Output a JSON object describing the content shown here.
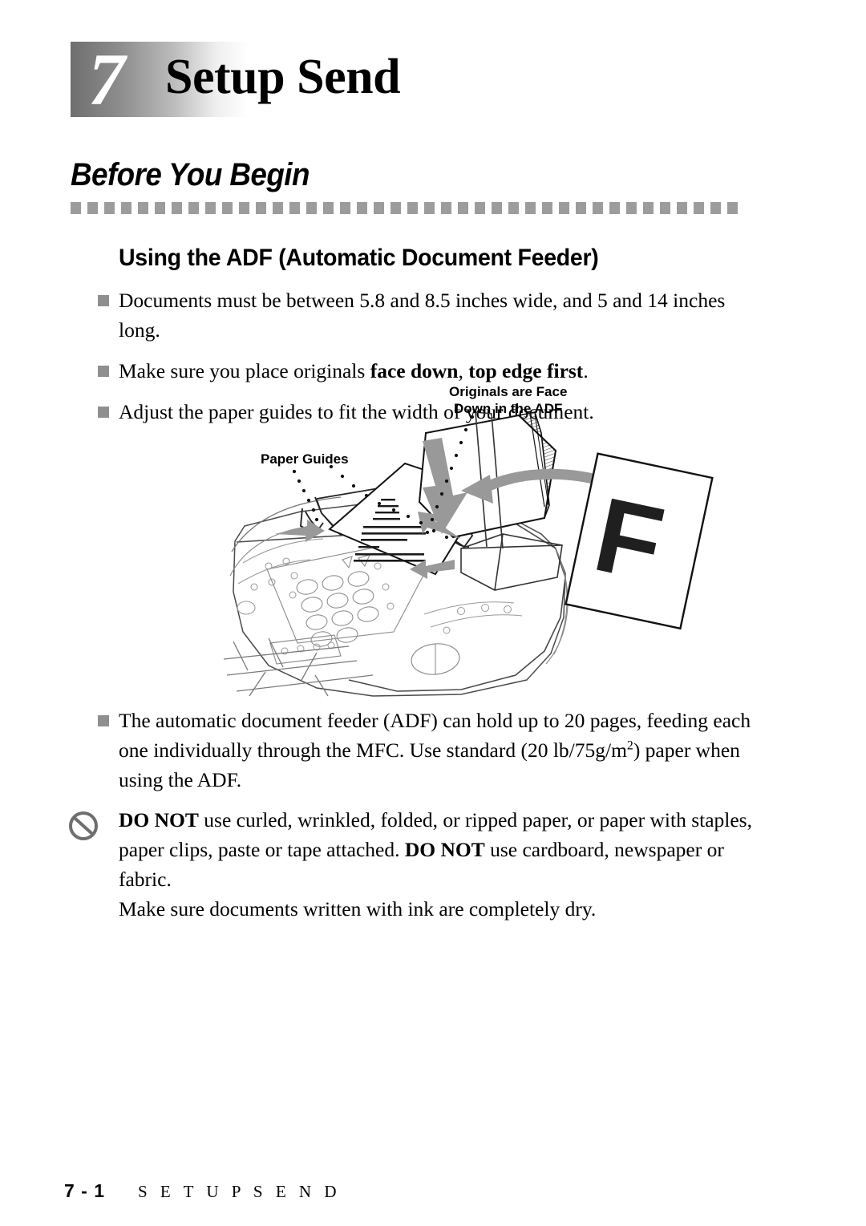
{
  "chapter": {
    "number": "7",
    "title": "Setup Send"
  },
  "section": {
    "heading": "Before You Begin",
    "sub_heading": "Using the ADF (Automatic Document Feeder)"
  },
  "bullets_top": [
    {
      "parts": [
        {
          "text": "Documents must be between 5.8 and 8.5 inches wide, and 5 and 14 inches long.",
          "style": "normal"
        }
      ]
    },
    {
      "parts": [
        {
          "text": "Make sure you place originals ",
          "style": "normal"
        },
        {
          "text": "face down",
          "style": "bold"
        },
        {
          "text": ", ",
          "style": "normal"
        },
        {
          "text": "top edge first",
          "style": "bold"
        },
        {
          "text": ".",
          "style": "normal"
        }
      ]
    },
    {
      "parts": [
        {
          "text": "Adjust the paper guides to fit the width of your document.",
          "style": "normal"
        }
      ]
    }
  ],
  "bullets_bottom": [
    {
      "parts": [
        {
          "text": "The automatic document feeder (ADF) can hold up to 20 pages, feeding each one individually through the MFC.  Use standard (20 lb/75g/m",
          "style": "normal"
        },
        {
          "text": "2",
          "style": "sup"
        },
        {
          "text": ") paper when using the ADF.",
          "style": "normal"
        }
      ]
    }
  ],
  "warning": {
    "icon": "prohibition-icon",
    "parts": [
      {
        "text": "DO NOT",
        "style": "bold"
      },
      {
        "text": " use curled, wrinkled, folded, or ripped paper, or paper with staples, paper clips, paste or tape attached. ",
        "style": "normal"
      },
      {
        "text": "DO NOT",
        "style": "bold"
      },
      {
        "text": " use cardboard, newspaper or fabric.",
        "style": "normal"
      }
    ],
    "line2": "Make sure documents written with ink are completely dry."
  },
  "illustration": {
    "label_originals_line1": "Originals are Face",
    "label_originals_line2": "Down in the ADF",
    "label_paper_guides": "Paper Guides",
    "page_letter": "F"
  },
  "footer": {
    "page_number": "7 - 1",
    "title": "S E T U P   S E N D"
  },
  "colors": {
    "bullet_marker": "#8f8f8f",
    "divider": "#9c9c9c",
    "warning_icon": "#6e6e6e",
    "arrow_gray": "#999999",
    "line_art": "#555555"
  }
}
